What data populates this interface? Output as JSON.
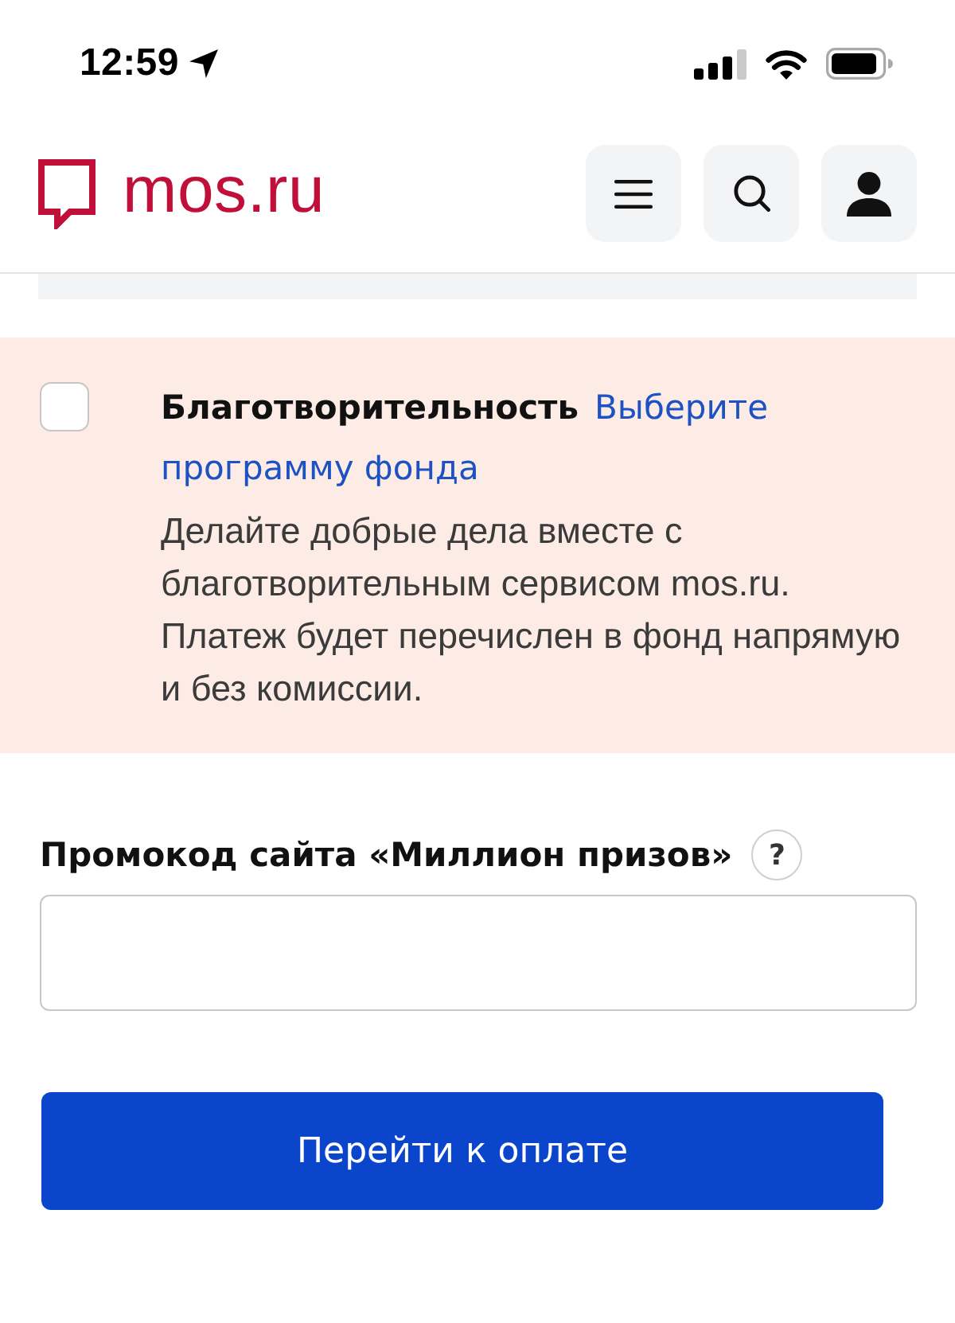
{
  "status_bar": {
    "time": "12:59"
  },
  "header": {
    "logo": "mos.ru"
  },
  "charity": {
    "checked": false,
    "title": "Благотворительность",
    "link": "Выберите программу фонда",
    "description": "Делайте добрые дела вместе с благотворительным сервисом mos.ru. Платеж будет перечислен в фонд напрямую и без комиссии."
  },
  "promo": {
    "label": "Промокод сайта «Миллион призов»",
    "help": "?"
  },
  "submit_button": "Перейти к оплате"
}
